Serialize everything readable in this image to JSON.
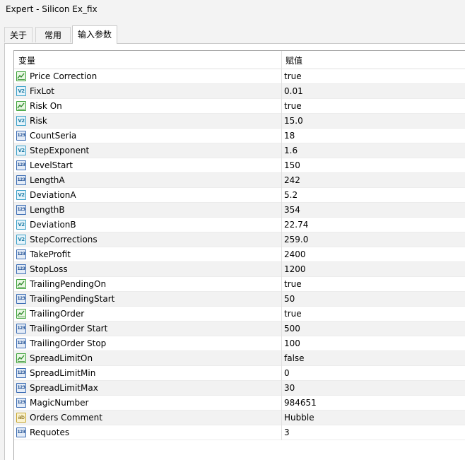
{
  "window": {
    "title": "Expert - Silicon Ex_fix"
  },
  "tabs": [
    {
      "label": "关于"
    },
    {
      "label": "常用"
    },
    {
      "label": "输入参数"
    }
  ],
  "active_tab": 2,
  "grid": {
    "col_variable": "变量",
    "col_value": "赋值",
    "rows": [
      {
        "name": "Price Correction",
        "value": "true",
        "type": "bool"
      },
      {
        "name": "FixLot",
        "value": "0.01",
        "type": "double"
      },
      {
        "name": "Risk On",
        "value": "true",
        "type": "bool"
      },
      {
        "name": "Risk",
        "value": "15.0",
        "type": "double"
      },
      {
        "name": "CountSeria",
        "value": "18",
        "type": "int"
      },
      {
        "name": "StepExponent",
        "value": "1.6",
        "type": "double"
      },
      {
        "name": "LevelStart",
        "value": "150",
        "type": "int"
      },
      {
        "name": "LengthA",
        "value": "242",
        "type": "int"
      },
      {
        "name": "DeviationA",
        "value": "5.2",
        "type": "double"
      },
      {
        "name": "LengthB",
        "value": "354",
        "type": "int"
      },
      {
        "name": "DeviationB",
        "value": "22.74",
        "type": "double"
      },
      {
        "name": "StepCorrections",
        "value": "259.0",
        "type": "double"
      },
      {
        "name": "TakeProfit",
        "value": "2400",
        "type": "int"
      },
      {
        "name": "StopLoss",
        "value": "1200",
        "type": "int"
      },
      {
        "name": "TrailingPendingOn",
        "value": "true",
        "type": "bool"
      },
      {
        "name": "TrailingPendingStart",
        "value": "50",
        "type": "int"
      },
      {
        "name": "TrailingOrder",
        "value": "true",
        "type": "bool"
      },
      {
        "name": "TrailingOrder Start",
        "value": "500",
        "type": "int"
      },
      {
        "name": "TrailingOrder Stop",
        "value": "100",
        "type": "int"
      },
      {
        "name": "SpreadLimitOn",
        "value": "false",
        "type": "bool"
      },
      {
        "name": "SpreadLimitMin",
        "value": "0",
        "type": "int"
      },
      {
        "name": "SpreadLimitMax",
        "value": "30",
        "type": "int"
      },
      {
        "name": "MagicNumber",
        "value": "984651",
        "type": "int"
      },
      {
        "name": "Orders Comment",
        "value": "Hubble",
        "type": "string"
      },
      {
        "name": "Requotes",
        "value": "3",
        "type": "int"
      }
    ]
  },
  "icons": {
    "bool": "bool-icon",
    "double": "double-icon",
    "int": "int-icon",
    "string": "string-icon"
  },
  "icon_glyphs": {
    "double": "V2",
    "int": "123",
    "string": "ab"
  },
  "colors": {
    "bool_border": "#3ea33a",
    "double_border": "#3aa0c8",
    "int_border": "#3c6db4",
    "string_border": "#c8a832",
    "row_alt": "#f2f2f2"
  }
}
